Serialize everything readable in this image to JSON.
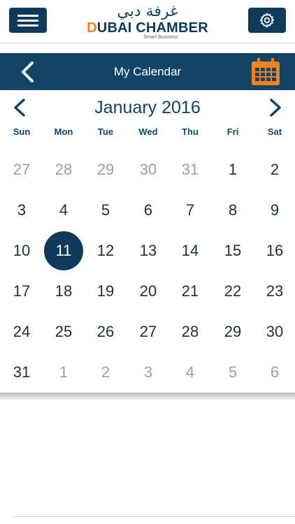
{
  "header": {
    "logo_arabic": "غرفة دبي",
    "logo_en_first": "D",
    "logo_en_rest": "UBAI CHAMBER",
    "logo_sub": "Smart Business",
    "menu_icon": "hamburger-icon",
    "settings_icon": "gear-icon"
  },
  "titlebar": {
    "title": "My Calendar",
    "back_icon": "chevron-left-icon",
    "calendar_icon": "calendar-icon"
  },
  "calendar": {
    "month_label": "January 2016",
    "weekdays": [
      "Sun",
      "Mon",
      "Tue",
      "Wed",
      "Thu",
      "Fri",
      "Sat"
    ],
    "selected_day": "11",
    "weeks": [
      [
        {
          "d": "27",
          "m": true
        },
        {
          "d": "28",
          "m": true
        },
        {
          "d": "29",
          "m": true
        },
        {
          "d": "30",
          "m": true
        },
        {
          "d": "31",
          "m": true
        },
        {
          "d": "1",
          "m": false
        },
        {
          "d": "2",
          "m": false
        }
      ],
      [
        {
          "d": "3",
          "m": false
        },
        {
          "d": "4",
          "m": false
        },
        {
          "d": "5",
          "m": false
        },
        {
          "d": "6",
          "m": false
        },
        {
          "d": "7",
          "m": false
        },
        {
          "d": "8",
          "m": false
        },
        {
          "d": "9",
          "m": false
        }
      ],
      [
        {
          "d": "10",
          "m": false
        },
        {
          "d": "11",
          "m": false
        },
        {
          "d": "12",
          "m": false
        },
        {
          "d": "13",
          "m": false
        },
        {
          "d": "14",
          "m": false
        },
        {
          "d": "15",
          "m": false
        },
        {
          "d": "16",
          "m": false
        }
      ],
      [
        {
          "d": "17",
          "m": false
        },
        {
          "d": "18",
          "m": false
        },
        {
          "d": "19",
          "m": false
        },
        {
          "d": "20",
          "m": false
        },
        {
          "d": "21",
          "m": false
        },
        {
          "d": "22",
          "m": false
        },
        {
          "d": "23",
          "m": false
        }
      ],
      [
        {
          "d": "24",
          "m": false
        },
        {
          "d": "25",
          "m": false
        },
        {
          "d": "26",
          "m": false
        },
        {
          "d": "27",
          "m": false
        },
        {
          "d": "28",
          "m": false
        },
        {
          "d": "29",
          "m": false
        },
        {
          "d": "30",
          "m": false
        }
      ],
      [
        {
          "d": "31",
          "m": false
        },
        {
          "d": "1",
          "m": true
        },
        {
          "d": "2",
          "m": true
        },
        {
          "d": "3",
          "m": true
        },
        {
          "d": "4",
          "m": true
        },
        {
          "d": "5",
          "m": true
        },
        {
          "d": "6",
          "m": true
        }
      ]
    ]
  },
  "colors": {
    "brand_navy": "#134466",
    "brand_orange": "#f4811f",
    "selected_fill": "#0f3a5a",
    "muted_text": "#9b9fa3"
  }
}
